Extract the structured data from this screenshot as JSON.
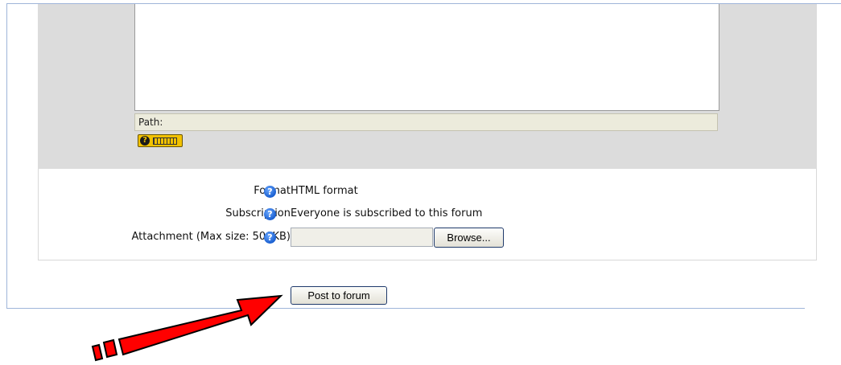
{
  "editor": {
    "path_label": "Path:",
    "kbd_help_icon": "keyboard-help-icon"
  },
  "form": {
    "format": {
      "label": "Format",
      "value": "HTML format",
      "icon": "help-icon"
    },
    "subscription": {
      "label": "Subscription",
      "value": "Everyone is subscribed to this forum",
      "icon": "help-icon"
    },
    "attachment": {
      "label": "Attachment (Max size: 500KB)",
      "icon": "help-icon",
      "file_value": "",
      "browse_label": "Browse..."
    }
  },
  "actions": {
    "post_label": "Post to forum"
  },
  "annotation": {
    "arrow_color": "#ff0000",
    "arrow_icon": "red-pointer-arrow"
  }
}
